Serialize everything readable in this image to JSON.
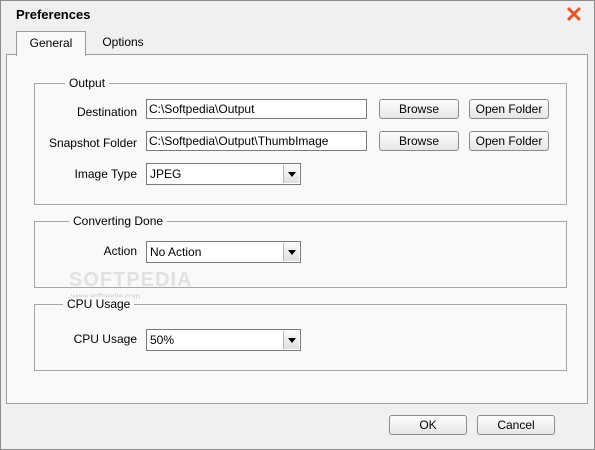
{
  "window": {
    "title": "Preferences",
    "close_glyph": "✕"
  },
  "tabs": [
    {
      "label": "General",
      "active": true
    },
    {
      "label": "Options",
      "active": false
    }
  ],
  "output": {
    "legend": "Output",
    "destination_label": "Destination",
    "destination_value": "C:\\Softpedia\\Output",
    "snapshot_label": "Snapshot Folder",
    "snapshot_value": "C:\\Softpedia\\Output\\ThumbImage",
    "image_type_label": "Image Type",
    "image_type_value": "JPEG",
    "browse_label": "Browse",
    "open_folder_label": "Open Folder"
  },
  "converting": {
    "legend": "Converting Done",
    "action_label": "Action",
    "action_value": "No Action"
  },
  "cpu": {
    "legend": "CPU Usage",
    "usage_label": "CPU Usage",
    "usage_value": "50%"
  },
  "watermark": {
    "text": "SOFTPEDIA",
    "subtext": "www.softpedia.com"
  },
  "footer": {
    "ok_label": "OK",
    "cancel_label": "Cancel"
  },
  "colors": {
    "close_icon": "#e2562a",
    "background": "#f0f0f0",
    "panel": "#f9f9f9"
  }
}
